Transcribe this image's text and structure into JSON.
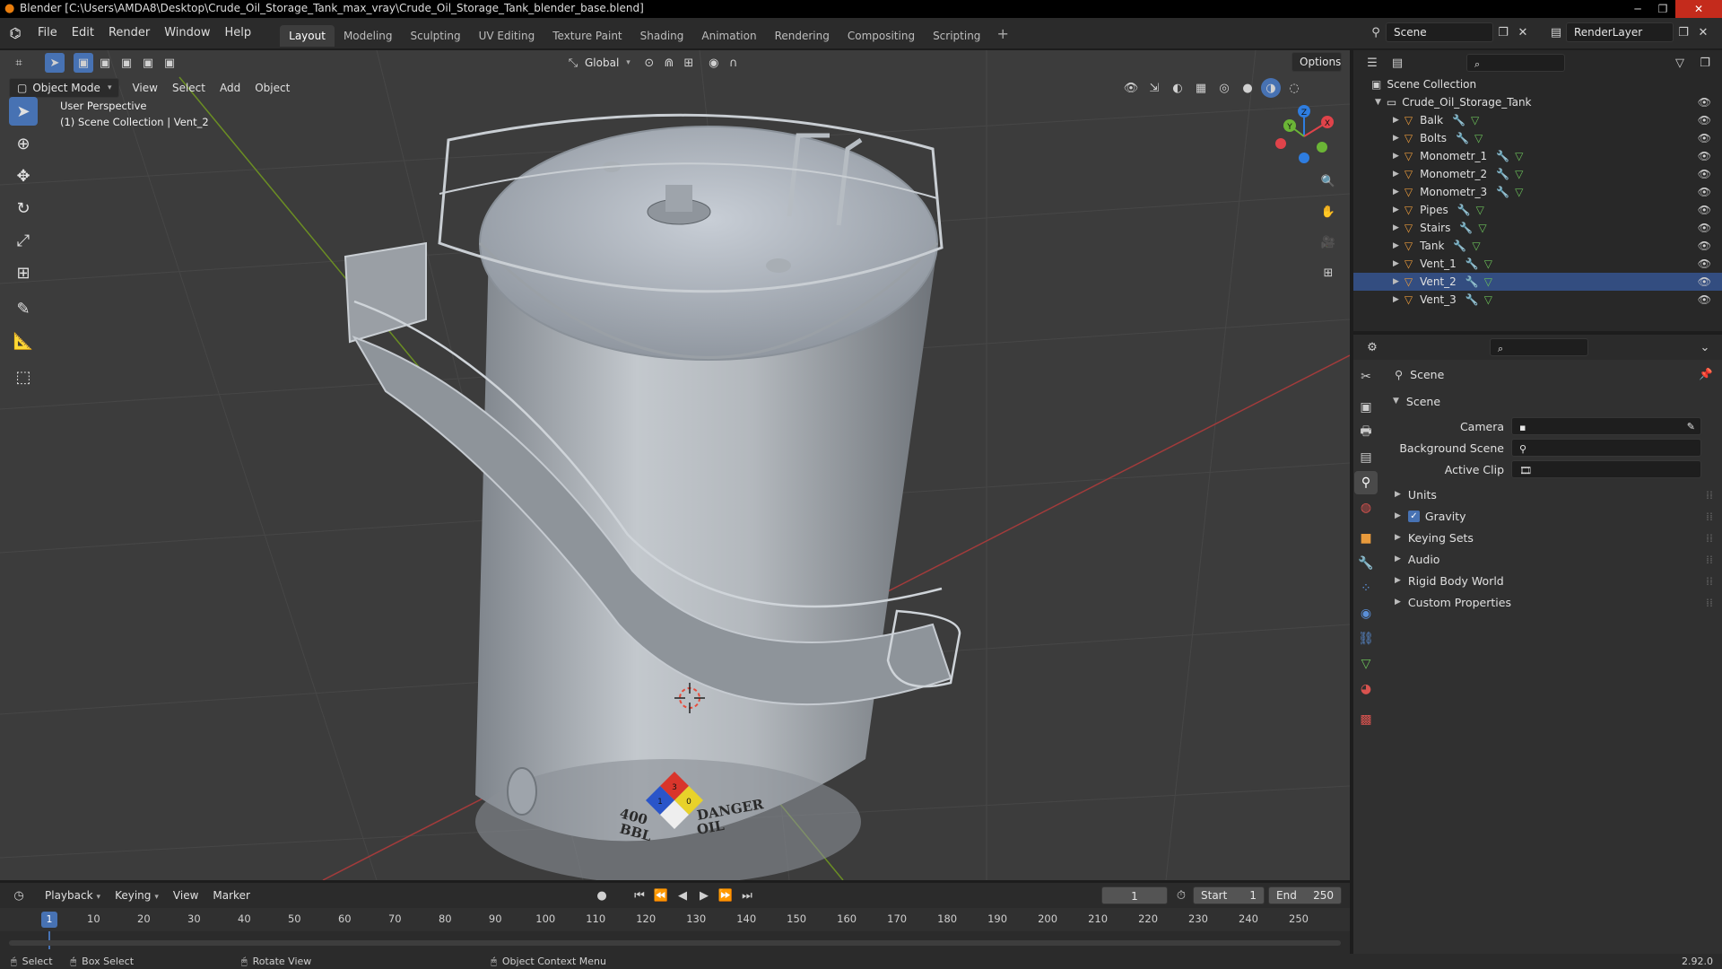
{
  "window": {
    "title": "Blender [C:\\Users\\AMDA8\\Desktop\\Crude_Oil_Storage_Tank_max_vray\\Crude_Oil_Storage_Tank_blender_base.blend]"
  },
  "menu": [
    "File",
    "Edit",
    "Render",
    "Window",
    "Help"
  ],
  "workspaces": [
    "Layout",
    "Modeling",
    "Sculpting",
    "UV Editing",
    "Texture Paint",
    "Shading",
    "Animation",
    "Rendering",
    "Compositing",
    "Scripting"
  ],
  "active_workspace": "Layout",
  "scene_field": "Scene",
  "renderlayer_field": "RenderLayer",
  "viewport": {
    "mode": "Object Mode",
    "menus": [
      "View",
      "Select",
      "Add",
      "Object"
    ],
    "transform_orientation": "Global",
    "options_label": "Options",
    "overlay_title": "User Perspective",
    "overlay_subtitle": "(1) Scene Collection | Vent_2",
    "gizmo_axes": {
      "x": "X",
      "y": "Y",
      "z": "Z"
    },
    "decal": {
      "left_line1": "400",
      "left_line2": "BBL",
      "right_line1": "DANGER",
      "right_line2": "OIL",
      "hazard_numbers": [
        "1",
        "3",
        "0"
      ]
    }
  },
  "outliner": {
    "root": "Scene Collection",
    "collection": "Crude_Oil_Storage_Tank",
    "items": [
      "Balk",
      "Bolts",
      "Monometr_1",
      "Monometr_2",
      "Monometr_3",
      "Pipes",
      "Stairs",
      "Tank",
      "Vent_1",
      "Vent_2",
      "Vent_3"
    ],
    "selected": "Vent_2"
  },
  "properties": {
    "context": "Scene",
    "panel": "Scene",
    "camera_label": "Camera",
    "background_scene_label": "Background Scene",
    "active_clip_label": "Active Clip",
    "subpanels": [
      "Units",
      "Gravity",
      "Keying Sets",
      "Audio",
      "Rigid Body World",
      "Custom Properties"
    ],
    "gravity_checked": true
  },
  "timeline": {
    "menus": [
      "Playback",
      "Keying",
      "View",
      "Marker"
    ],
    "current_frame": "1",
    "start_label": "Start",
    "start_value": "1",
    "end_label": "End",
    "end_value": "250",
    "ruler": [
      "10",
      "20",
      "30",
      "40",
      "50",
      "60",
      "70",
      "80",
      "90",
      "100",
      "110",
      "120",
      "130",
      "140",
      "150",
      "160",
      "170",
      "180",
      "190",
      "200",
      "210",
      "220",
      "230",
      "240",
      "250"
    ],
    "playhead_label": "1"
  },
  "statusbar": {
    "select": "Select",
    "box_select": "Box Select",
    "rotate_view": "Rotate View",
    "context_menu": "Object Context Menu",
    "version": "2.92.0"
  }
}
